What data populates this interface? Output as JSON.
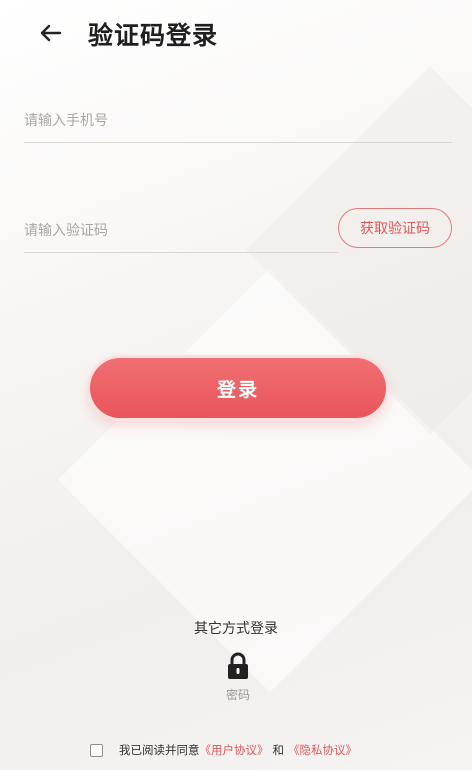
{
  "header": {
    "title": "验证码登录"
  },
  "phone": {
    "placeholder": "请输入手机号",
    "value": ""
  },
  "code": {
    "placeholder": "请输入验证码",
    "value": "",
    "get_code_label": "获取验证码"
  },
  "login": {
    "label": "登录"
  },
  "other_login": {
    "title": "其它方式登录",
    "password_label": "密码"
  },
  "agreement": {
    "prefix": "我已阅读并同意",
    "user_agreement": "《用户协议》",
    "and": "和",
    "privacy_policy": "《隐私协议》",
    "checked": false
  },
  "colors": {
    "accent": "#e8555b",
    "text": "#1f1f1f",
    "placeholder": "#a9a6a4"
  },
  "icons": {
    "back": "arrow-left-icon",
    "password": "lock-icon"
  }
}
